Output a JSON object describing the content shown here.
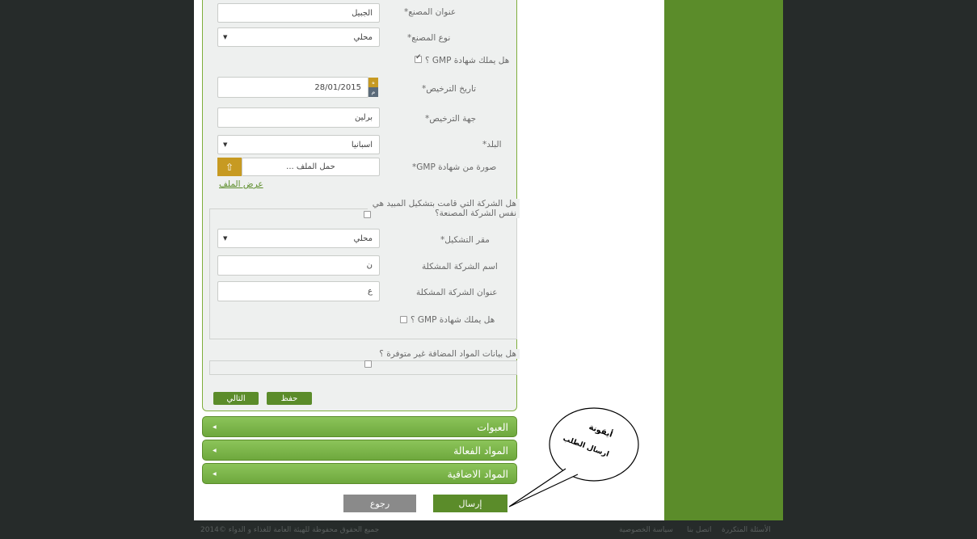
{
  "form": {
    "factory_address": {
      "label": "عنوان المصنع*",
      "value": "الجبيل"
    },
    "factory_type": {
      "label": "نوع المصنع*",
      "value": "محلي"
    },
    "gmp_question": {
      "label": "هل يملك شهادة GMP ؟",
      "checked": true
    },
    "license_date": {
      "label": "تاريخ الترخيص*",
      "value": "28/01/2015",
      "cal_top": "ه",
      "cal_bottom": "م"
    },
    "license_authority": {
      "label": "جهة الترخيص*",
      "value": "برلين"
    },
    "country": {
      "label": "البلد*",
      "value": "اسبانيا"
    },
    "gmp_image": {
      "label": "صورة من شهادة GMP*",
      "value": "حمل الملف ..."
    },
    "view_file_link": "عرض الملف",
    "same_company": {
      "label": "هل الشركة التي قامت بتشكيل المبيد هي نفس الشركة المصنعة؟",
      "checked": false
    },
    "formulation_place": {
      "label": "مقر التشكيل*",
      "value": "محلي"
    },
    "formulating_company_name": {
      "label": "اسم الشركة المشكلة",
      "value": "ن"
    },
    "formulating_company_address": {
      "label": "عنوان الشركة المشكلة",
      "value": "ع"
    },
    "formulator_gmp": {
      "label": "هل يملك شهادة GMP ؟",
      "checked": false
    },
    "additives_unavailable": {
      "label": "هل بيانات المواد المضافة غير متوفرة ؟",
      "checked": false
    },
    "save_button": "حفظ",
    "next_button": "التالي"
  },
  "accordion": [
    "العبوات",
    "المواد الفعالة",
    "المواد الاضافية"
  ],
  "actions": {
    "submit": "إرسال",
    "back": "رجوع"
  },
  "callout": {
    "line1": "أيقونة",
    "line2": "ارسال الطلب"
  },
  "footer": {
    "copyright": "جميع الحقوق محفوظة للهيئة العامة للغذاء و الدواء ©2014",
    "links": [
      "الأسئلة المتكررة",
      "اتصل بنا",
      "سياسة الخصوصية"
    ]
  },
  "colors": {
    "brand_green": "#5b8c2a",
    "accent_gold": "#c79a22",
    "back_gray": "#8a8a8a"
  }
}
